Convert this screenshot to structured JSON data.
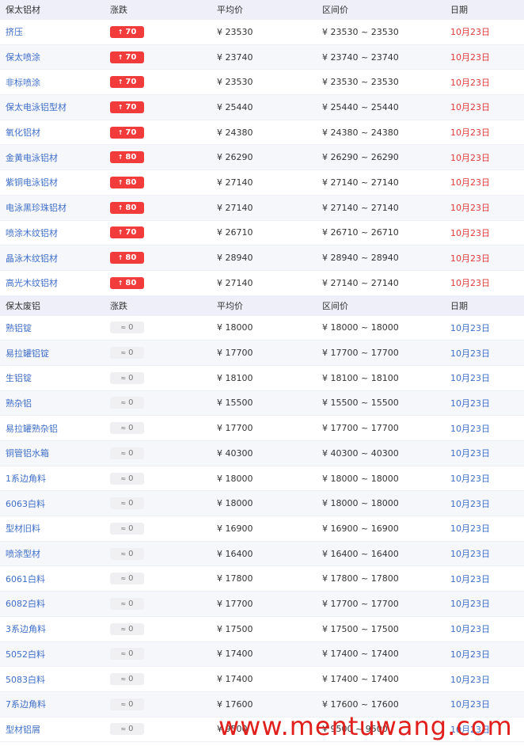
{
  "section1": {
    "headers": {
      "name": "保太铝材",
      "change": "涨跌",
      "avg": "平均价",
      "range": "区间价",
      "date": "日期"
    },
    "rows": [
      {
        "name": "挤压",
        "change": "70",
        "avg": "¥ 23530",
        "range": "¥ 23530 ~ 23530",
        "date": "10月23日"
      },
      {
        "name": "保太喷涂",
        "change": "70",
        "avg": "¥ 23740",
        "range": "¥ 23740 ~ 23740",
        "date": "10月23日"
      },
      {
        "name": "非标喷涂",
        "change": "70",
        "avg": "¥ 23530",
        "range": "¥ 23530 ~ 23530",
        "date": "10月23日"
      },
      {
        "name": "保太电泳铝型材",
        "change": "70",
        "avg": "¥ 25440",
        "range": "¥ 25440 ~ 25440",
        "date": "10月23日"
      },
      {
        "name": "氧化铝材",
        "change": "70",
        "avg": "¥ 24380",
        "range": "¥ 24380 ~ 24380",
        "date": "10月23日"
      },
      {
        "name": "金黄电泳铝材",
        "change": "80",
        "avg": "¥ 26290",
        "range": "¥ 26290 ~ 26290",
        "date": "10月23日"
      },
      {
        "name": "紫铜电泳铝材",
        "change": "80",
        "avg": "¥ 27140",
        "range": "¥ 27140 ~ 27140",
        "date": "10月23日"
      },
      {
        "name": "电泳黑珍珠铝材",
        "change": "80",
        "avg": "¥ 27140",
        "range": "¥ 27140 ~ 27140",
        "date": "10月23日"
      },
      {
        "name": "喷涂木纹铝材",
        "change": "70",
        "avg": "¥ 26710",
        "range": "¥ 26710 ~ 26710",
        "date": "10月23日"
      },
      {
        "name": "晶泳木纹铝材",
        "change": "80",
        "avg": "¥ 28940",
        "range": "¥ 28940 ~ 28940",
        "date": "10月23日"
      },
      {
        "name": "高光木纹铝材",
        "change": "80",
        "avg": "¥ 27140",
        "range": "¥ 27140 ~ 27140",
        "date": "10月23日"
      }
    ]
  },
  "section2": {
    "headers": {
      "name": "保太废铝",
      "change": "涨跌",
      "avg": "平均价",
      "range": "区间价",
      "date": "日期"
    },
    "rows": [
      {
        "name": "熟铝锭",
        "change": "0",
        "avg": "¥ 18000",
        "range": "¥ 18000 ~ 18000",
        "date": "10月23日"
      },
      {
        "name": "易拉罐铝锭",
        "change": "0",
        "avg": "¥ 17700",
        "range": "¥ 17700 ~ 17700",
        "date": "10月23日"
      },
      {
        "name": "生铝锭",
        "change": "0",
        "avg": "¥ 18100",
        "range": "¥ 18100 ~ 18100",
        "date": "10月23日"
      },
      {
        "name": "熟杂铝",
        "change": "0",
        "avg": "¥ 15500",
        "range": "¥ 15500 ~ 15500",
        "date": "10月23日"
      },
      {
        "name": "易拉罐熟杂铝",
        "change": "0",
        "avg": "¥ 17700",
        "range": "¥ 17700 ~ 17700",
        "date": "10月23日"
      },
      {
        "name": "铜管铝水箱",
        "change": "0",
        "avg": "¥ 40300",
        "range": "¥ 40300 ~ 40300",
        "date": "10月23日"
      },
      {
        "name": "1系边角料",
        "change": "0",
        "avg": "¥ 18000",
        "range": "¥ 18000 ~ 18000",
        "date": "10月23日"
      },
      {
        "name": "6063白料",
        "change": "0",
        "avg": "¥ 18000",
        "range": "¥ 18000 ~ 18000",
        "date": "10月23日"
      },
      {
        "name": "型材旧料",
        "change": "0",
        "avg": "¥ 16900",
        "range": "¥ 16900 ~ 16900",
        "date": "10月23日"
      },
      {
        "name": "喷涂型材",
        "change": "0",
        "avg": "¥ 16400",
        "range": "¥ 16400 ~ 16400",
        "date": "10月23日"
      },
      {
        "name": "6061白料",
        "change": "0",
        "avg": "¥ 17800",
        "range": "¥ 17800 ~ 17800",
        "date": "10月23日"
      },
      {
        "name": "6082白料",
        "change": "0",
        "avg": "¥ 17700",
        "range": "¥ 17700 ~ 17700",
        "date": "10月23日"
      },
      {
        "name": "3系边角料",
        "change": "0",
        "avg": "¥ 17500",
        "range": "¥ 17500 ~ 17500",
        "date": "10月23日"
      },
      {
        "name": "5052白料",
        "change": "0",
        "avg": "¥ 17400",
        "range": "¥ 17400 ~ 17400",
        "date": "10月23日"
      },
      {
        "name": "5083白料",
        "change": "0",
        "avg": "¥ 17400",
        "range": "¥ 17400 ~ 17400",
        "date": "10月23日"
      },
      {
        "name": "7系边角料",
        "change": "0",
        "avg": "¥ 17600",
        "range": "¥ 17600 ~ 17600",
        "date": "10月23日"
      },
      {
        "name": "型材铝屑",
        "change": "0",
        "avg": "¥ 9500",
        "range": "¥ 9500 ~ 9500",
        "date": "10月23日"
      }
    ]
  },
  "icons": {
    "up": "arrow-up-icon",
    "flat": "approx-icon"
  },
  "colors": {
    "up_badge": "#f23b3b",
    "date_red": "#e03a3a",
    "link_blue": "#3f6fc8",
    "header_bg": "#eeeff9"
  },
  "watermark": "www.mentuwang.com"
}
